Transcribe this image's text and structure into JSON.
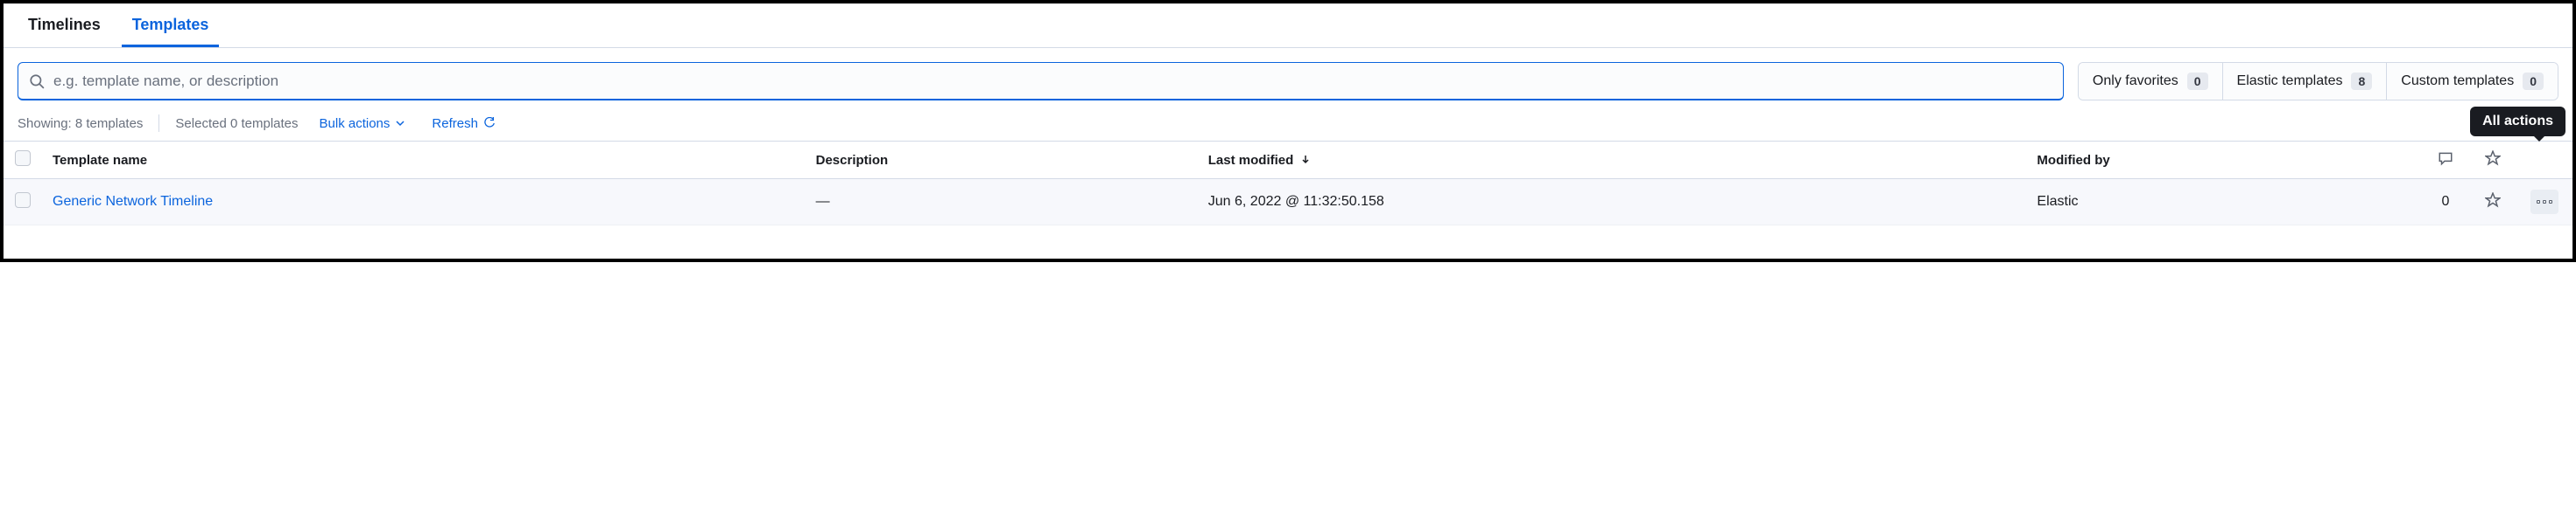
{
  "tabs": {
    "timelines": "Timelines",
    "templates": "Templates"
  },
  "search": {
    "placeholder": "e.g. template name, or description"
  },
  "filters": {
    "only_favorites": {
      "label": "Only favorites",
      "count": "0"
    },
    "elastic_templates": {
      "label": "Elastic templates",
      "count": "8"
    },
    "custom_templates": {
      "label": "Custom templates",
      "count": "0"
    }
  },
  "status": {
    "showing": "Showing: 8 templates",
    "selected": "Selected 0 templates",
    "bulk_actions": "Bulk actions",
    "refresh": "Refresh"
  },
  "columns": {
    "template_name": "Template name",
    "description": "Description",
    "last_modified": "Last modified",
    "modified_by": "Modified by"
  },
  "rows": [
    {
      "name": "Generic Network Timeline",
      "description": "—",
      "last_modified": "Jun 6, 2022 @ 11:32:50.158",
      "modified_by": "Elastic",
      "comments": "0"
    }
  ],
  "tooltip": {
    "all_actions": "All actions"
  }
}
